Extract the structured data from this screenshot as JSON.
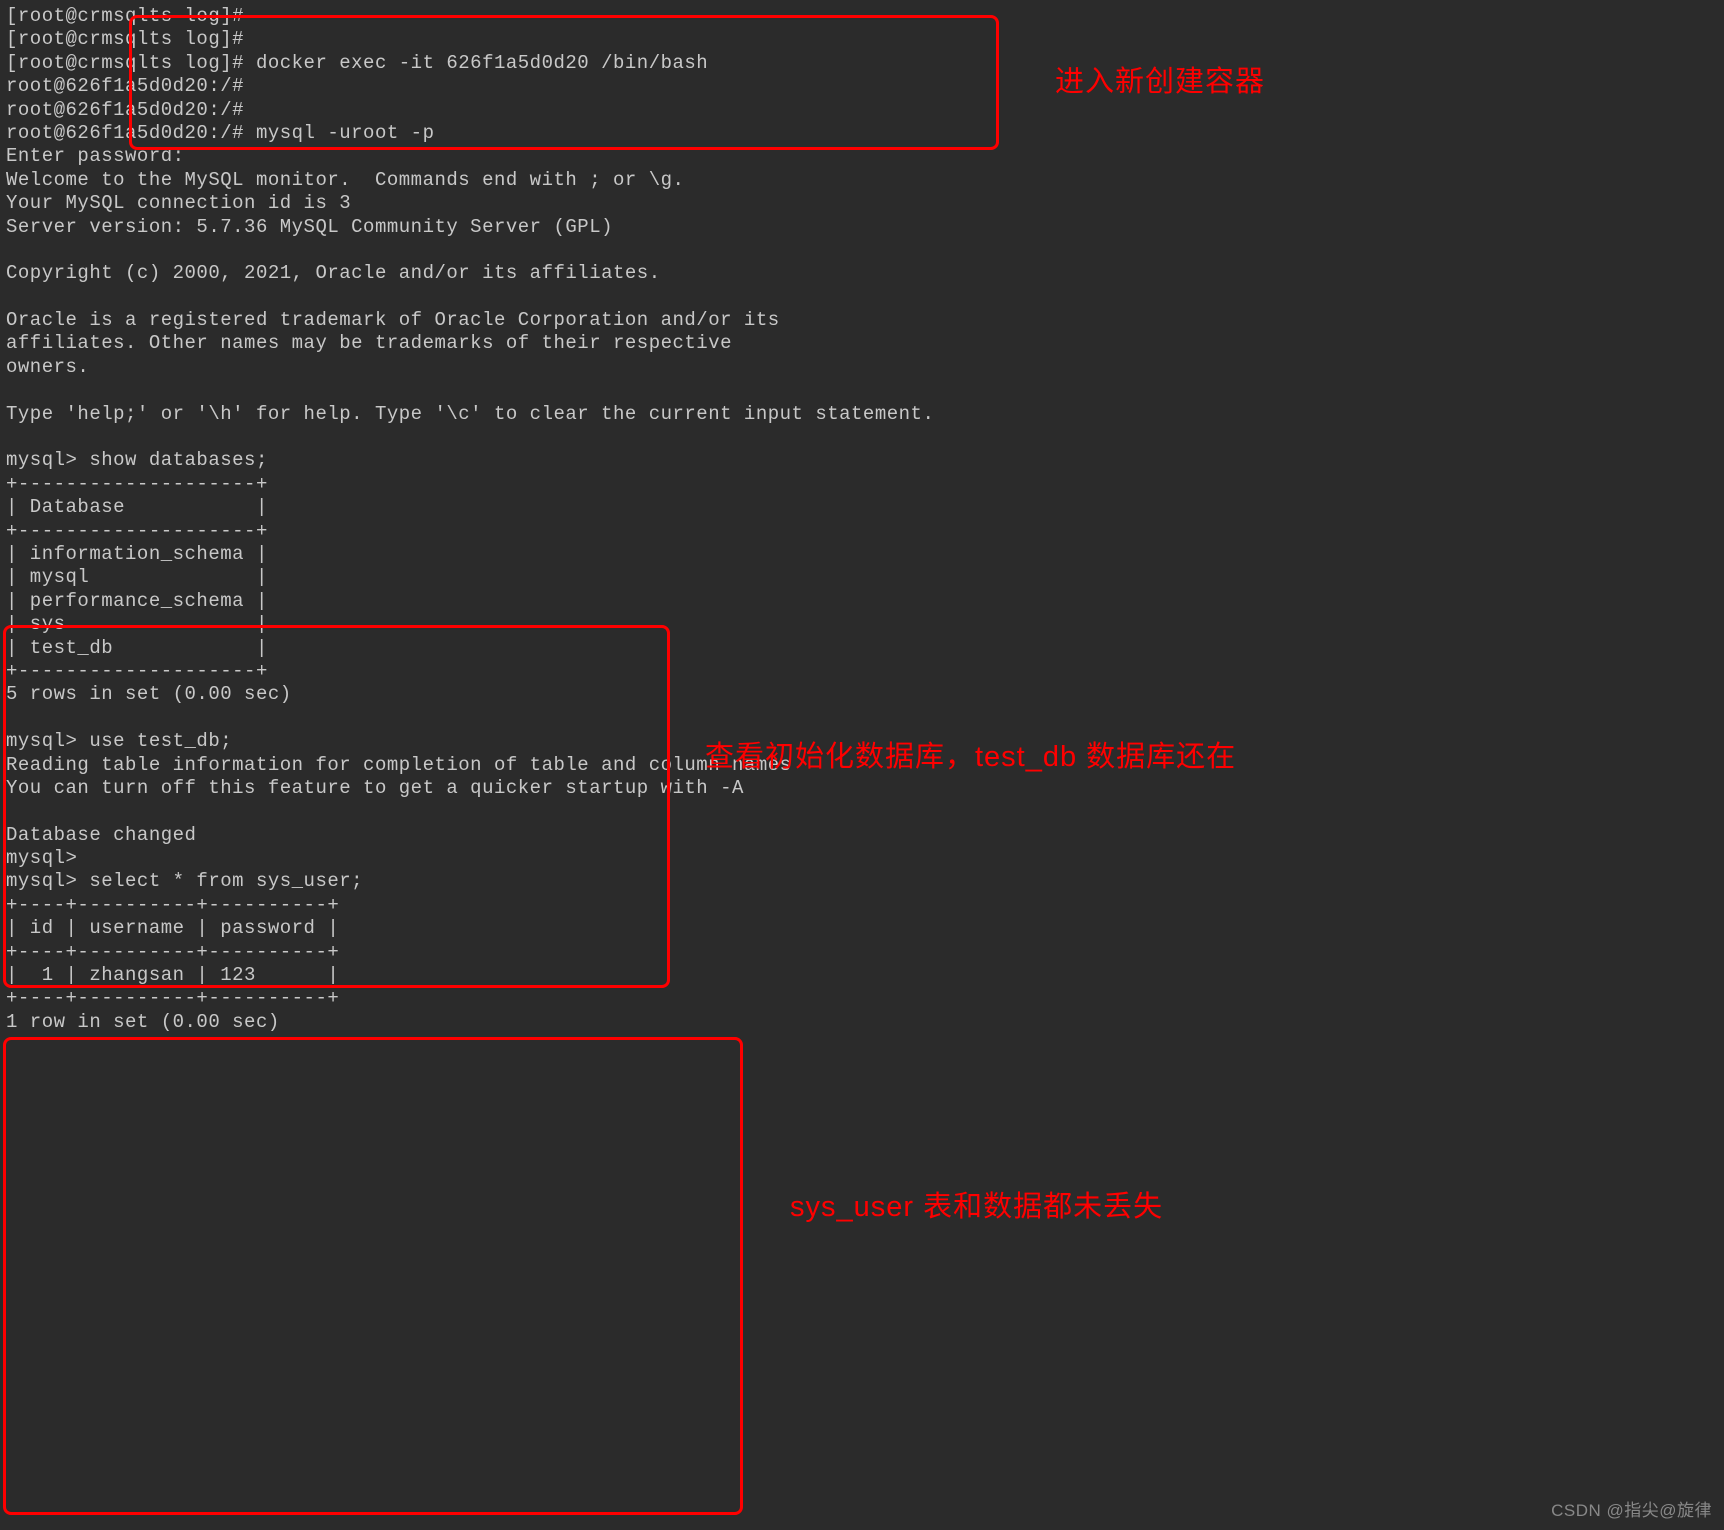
{
  "terminal": {
    "lines": [
      "[root@crmsqlts log]#",
      "[root@crmsqlts log]#",
      "[root@crmsqlts log]# docker exec -it 626f1a5d0d20 /bin/bash",
      "root@626f1a5d0d20:/#",
      "root@626f1a5d0d20:/#",
      "root@626f1a5d0d20:/# mysql -uroot -p",
      "Enter password:",
      "Welcome to the MySQL monitor.  Commands end with ; or \\g.",
      "Your MySQL connection id is 3",
      "Server version: 5.7.36 MySQL Community Server (GPL)",
      "",
      "Copyright (c) 2000, 2021, Oracle and/or its affiliates.",
      "",
      "Oracle is a registered trademark of Oracle Corporation and/or its",
      "affiliates. Other names may be trademarks of their respective",
      "owners.",
      "",
      "Type 'help;' or '\\h' for help. Type '\\c' to clear the current input statement.",
      "",
      "mysql> show databases;",
      "+--------------------+",
      "| Database           |",
      "+--------------------+",
      "| information_schema |",
      "| mysql              |",
      "| performance_schema |",
      "| sys                |",
      "| test_db            |",
      "+--------------------+",
      "5 rows in set (0.00 sec)",
      "",
      "mysql> use test_db;",
      "Reading table information for completion of table and column names",
      "You can turn off this feature to get a quicker startup with -A",
      "",
      "Database changed",
      "mysql>",
      "mysql> select * from sys_user;",
      "+----+----------+----------+",
      "| id | username | password |",
      "+----+----------+----------+",
      "|  1 | zhangsan | 123      |",
      "+----+----------+----------+",
      "1 row in set (0.00 sec)"
    ]
  },
  "annotations": {
    "a1": "进入新创建容器",
    "a2": "查看初始化数据库，test_db 数据库还在",
    "a3": "sys_user 表和数据都未丢失"
  },
  "watermark": "CSDN @指尖@旋律"
}
